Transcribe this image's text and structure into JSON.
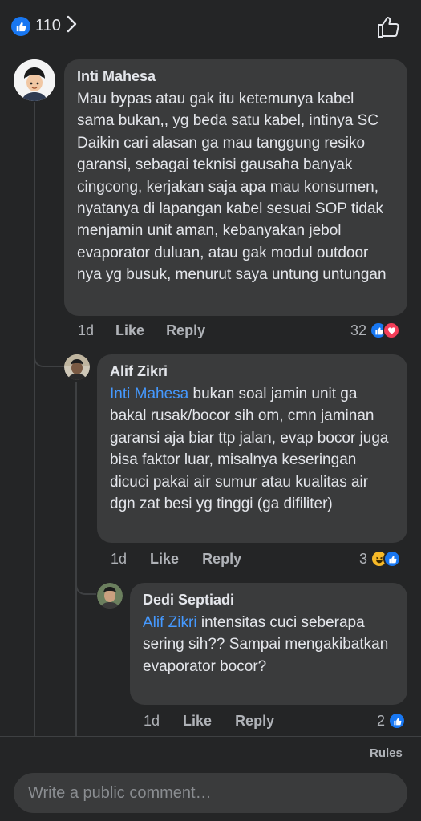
{
  "header": {
    "reaction_count": "110"
  },
  "comments": [
    {
      "author": "Inti Mahesa",
      "mention": "",
      "text": "Mau bypas atau gak itu ketemunya kabel sama bukan,, yg beda satu kabel, intinya SC Daikin cari alasan ga mau tanggung resiko garansi, sebagai teknisi gausaha banyak cingcong, kerjakan saja apa mau konsumen, nyatanya di lapangan kabel sesuai SOP tidak menjamin unit aman, kebanyakan jebol evaporator duluan, atau gak modul outdoor nya yg busuk, menurut saya untung untungan",
      "time": "1d",
      "like_label": "Like",
      "reply_label": "Reply",
      "reaction_count": "32",
      "reactions": [
        "like",
        "love"
      ]
    },
    {
      "author": "Alif Zikri",
      "mention": "Inti Mahesa",
      "text": " bukan soal jamin unit ga bakal rusak/bocor sih om, cmn jaminan garansi aja biar ttp jalan, evap bocor juga bisa faktor luar, misalnya keseringan dicuci pakai air sumur atau kualitas air dgn zat besi yg tinggi (ga difiliter)",
      "time": "1d",
      "like_label": "Like",
      "reply_label": "Reply",
      "reaction_count": "3",
      "reactions": [
        "haha",
        "like"
      ]
    },
    {
      "author": "Dedi Septiadi",
      "mention": "Alif Zikri",
      "text": " intensitas cuci seberapa sering sih?? Sampai mengakibatkan evaporator bocor?",
      "time": "1d",
      "like_label": "Like",
      "reply_label": "Reply",
      "reaction_count": "2",
      "reactions": [
        "like"
      ]
    }
  ],
  "footer": {
    "rules_label": "Rules",
    "compose_placeholder": "Write a public comment…"
  },
  "colors": {
    "background": "#242526",
    "bubble": "#3a3b3c",
    "mention": "#4599ff",
    "like_blue": "#1877f2",
    "love_red": "#f33e58",
    "haha_yellow": "#f7b928"
  }
}
